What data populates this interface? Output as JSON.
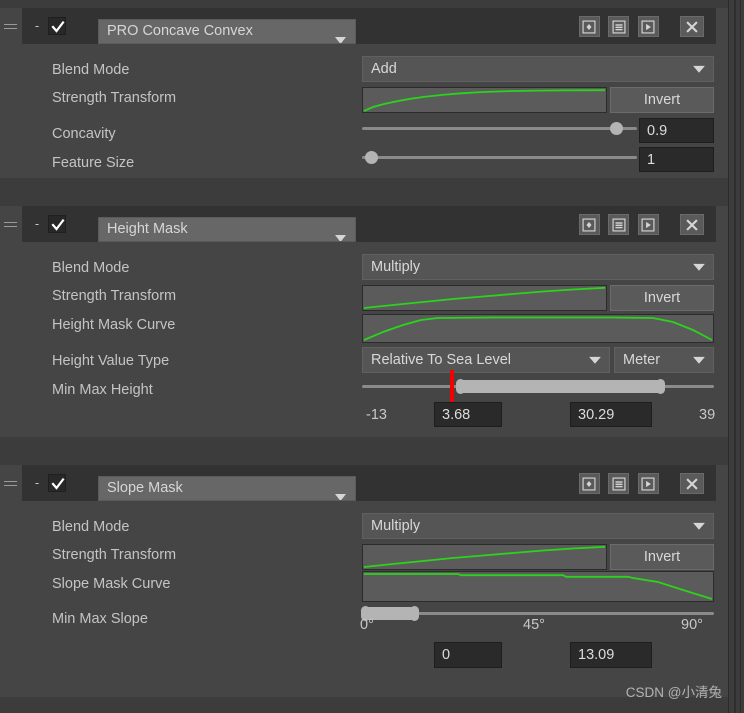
{
  "panels": [
    {
      "id": "pro-concave-convex",
      "name": "PRO Concave Convex",
      "foldout": "-",
      "enabled": true,
      "header_buttons": [
        "preset-icon",
        "list-icon",
        "play-icon"
      ],
      "close_label": "X",
      "rows": {
        "blend_mode_label": "Blend Mode",
        "blend_mode_value": "Add",
        "strength_transform_label": "Strength Transform",
        "invert_label": "Invert",
        "concavity_label": "Concavity",
        "concavity_value": "0.9",
        "feature_size_label": "Feature Size",
        "feature_size_value": "1"
      }
    },
    {
      "id": "height-mask",
      "name": "Height Mask",
      "foldout": "-",
      "enabled": true,
      "header_buttons": [
        "preset-icon",
        "list-icon",
        "play-icon"
      ],
      "close_label": "X",
      "rows": {
        "blend_mode_label": "Blend Mode",
        "blend_mode_value": "Multiply",
        "strength_transform_label": "Strength Transform",
        "invert_label": "Invert",
        "height_mask_curve_label": "Height Mask Curve",
        "height_value_type_label": "Height Value Type",
        "height_value_type_value": "Relative To Sea Level",
        "height_unit_value": "Meter",
        "min_max_height_label": "Min Max Height",
        "range_min_bound": "-13",
        "range_max_bound": "39",
        "min_value": "3.68",
        "max_value": "30.29"
      }
    },
    {
      "id": "slope-mask",
      "name": "Slope Mask",
      "foldout": "-",
      "enabled": true,
      "header_buttons": [
        "preset-icon",
        "list-icon",
        "play-icon"
      ],
      "close_label": "X",
      "rows": {
        "blend_mode_label": "Blend Mode",
        "blend_mode_value": "Multiply",
        "strength_transform_label": "Strength Transform",
        "invert_label": "Invert",
        "slope_mask_curve_label": "Slope Mask Curve",
        "min_max_slope_label": "Min Max Slope",
        "axis_0": "0°",
        "axis_45": "45°",
        "axis_90": "90°",
        "min_value": "0",
        "max_value": "13.09"
      }
    }
  ],
  "watermark": "CSDN @小清兔",
  "colors": {
    "curve_line": "#2bd41a",
    "marker_red": "#f30000",
    "panel_body": "#454545",
    "panel_header": "#323232",
    "window_bg": "#3c3c3c"
  }
}
